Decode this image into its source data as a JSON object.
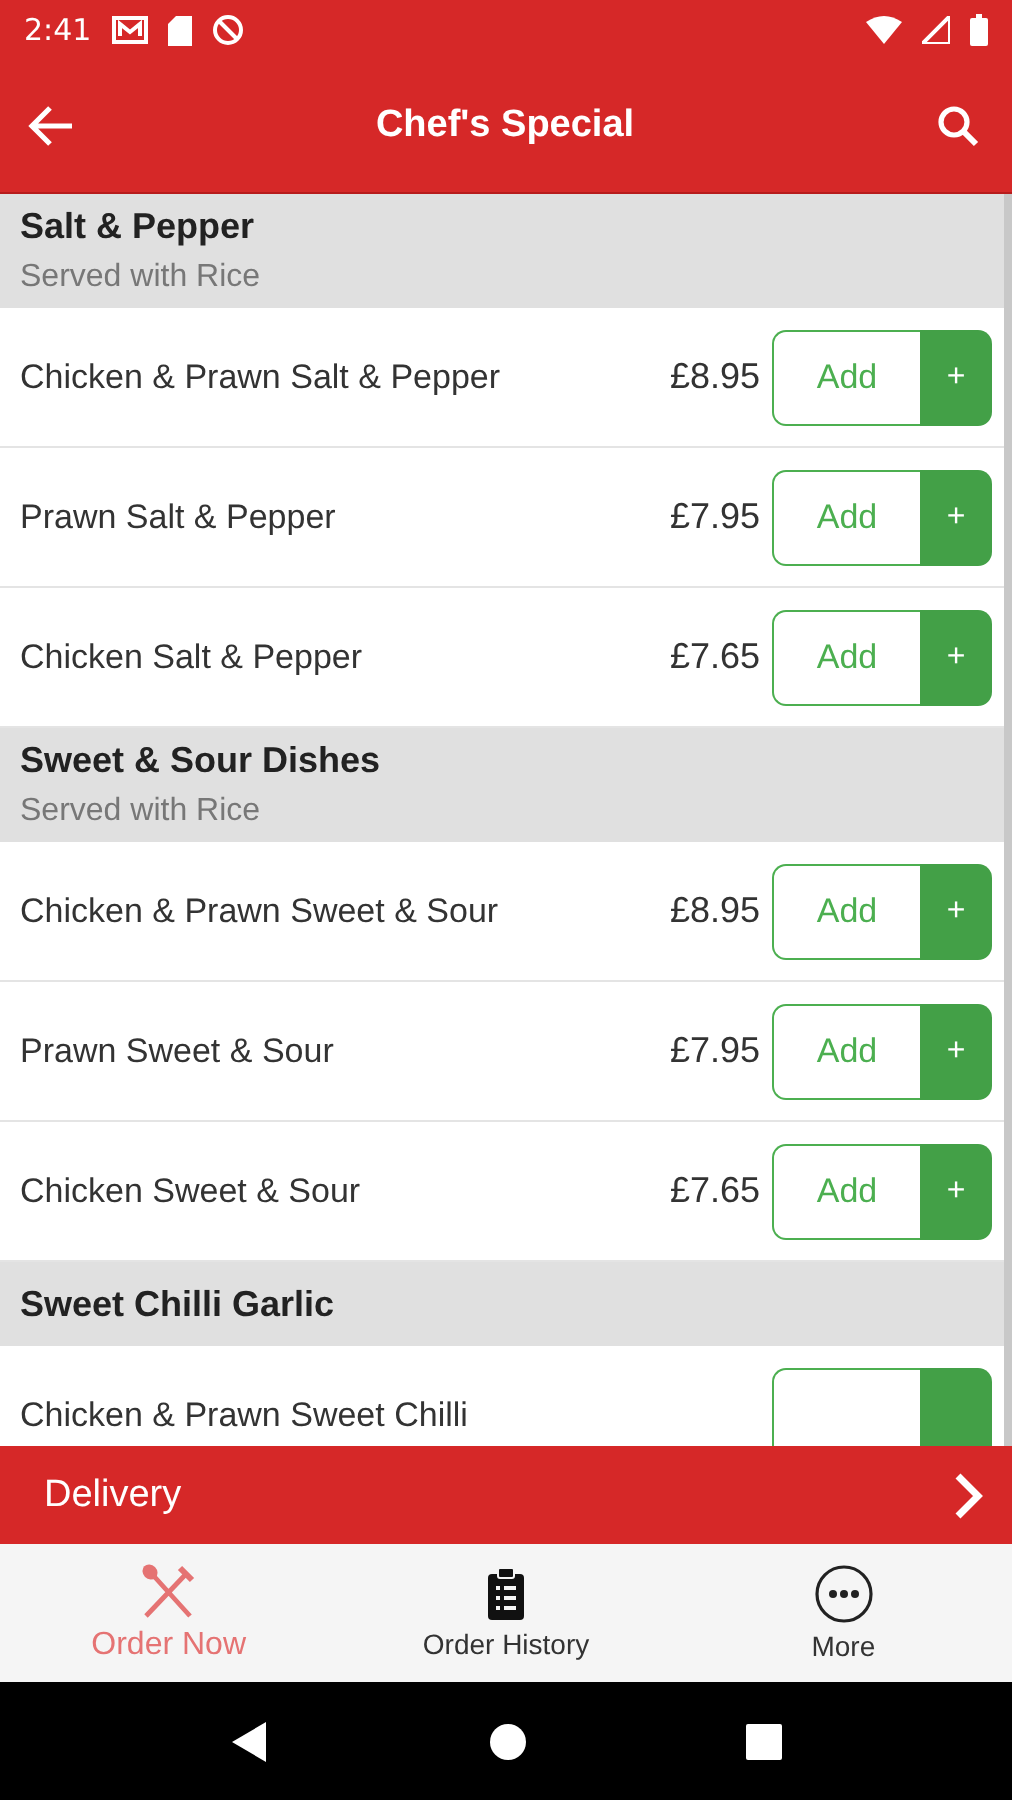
{
  "status_bar": {
    "time": "2:41"
  },
  "app_bar": {
    "title": "Chef's Special"
  },
  "sections": [
    {
      "title": "Salt & Pepper",
      "subtitle": "Served with Rice",
      "items": [
        {
          "name": "Chicken & Prawn Salt & Pepper",
          "price": "£8.95",
          "add": "Add",
          "plus": "+"
        },
        {
          "name": "Prawn Salt & Pepper",
          "price": "£7.95",
          "add": "Add",
          "plus": "+"
        },
        {
          "name": "Chicken Salt & Pepper",
          "price": "£7.65",
          "add": "Add",
          "plus": "+"
        }
      ]
    },
    {
      "title": "Sweet & Sour Dishes",
      "subtitle": "Served with Rice",
      "items": [
        {
          "name": "Chicken & Prawn Sweet & Sour",
          "price": "£8.95",
          "add": "Add",
          "plus": "+"
        },
        {
          "name": "Prawn Sweet & Sour",
          "price": "£7.95",
          "add": "Add",
          "plus": "+"
        },
        {
          "name": "Chicken Sweet & Sour",
          "price": "£7.65",
          "add": "Add",
          "plus": "+"
        }
      ]
    },
    {
      "title": "Sweet Chilli Garlic",
      "items": [
        {
          "name": "Chicken & Prawn Sweet Chilli"
        }
      ]
    }
  ],
  "delivery_bar": {
    "label": "Delivery"
  },
  "tabs": [
    {
      "label": "Order Now",
      "kind": "utensils",
      "selected": true
    },
    {
      "label": "Order History",
      "kind": "clipboard",
      "selected": false
    },
    {
      "label": "More",
      "kind": "more",
      "selected": false
    }
  ]
}
